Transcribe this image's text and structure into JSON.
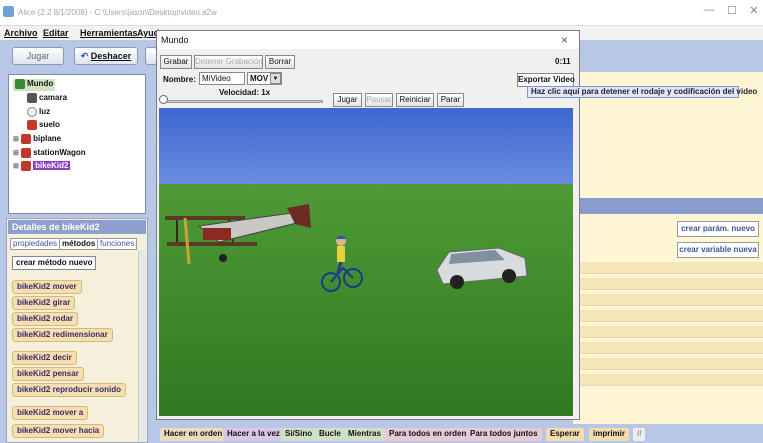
{
  "window": {
    "title": "Alice (2.2 8/1/2008) - C:\\Users\\jason\\Desktop\\video.a2w"
  },
  "menu": {
    "items": [
      "Archivo",
      "Editar",
      "Herramientas",
      "Ayuda"
    ]
  },
  "toolbar": {
    "play": "Jugar",
    "undo": "Deshacer"
  },
  "tree": {
    "root": "Mundo",
    "items": [
      "camara",
      "luz",
      "suelo",
      "biplane",
      "stationWagon",
      "bikeKid2"
    ]
  },
  "details": {
    "title": "Detalles de  bikeKid2",
    "tabs": [
      "propiedades",
      "métodos",
      "funciones"
    ],
    "new_method": "crear método nuevo",
    "methods": [
      "bikeKid2  mover",
      "bikeKid2  girar",
      "bikeKid2  rodar",
      "bikeKid2  redimensionar",
      "bikeKid2  decir",
      "bikeKid2  pensar",
      "bikeKid2  reproducir sonido",
      "bikeKid2  mover a",
      "bikeKid2  mover  hacia"
    ]
  },
  "editor": {
    "new_param": "crear parám. nuevo",
    "new_var": "crear variable nueva"
  },
  "bottom": {
    "items": [
      "Hacer en orden",
      "Hacer a la vez",
      "Si/Sino",
      "Bucle",
      "Mientras",
      "Para todos en orden",
      "Para todos juntos",
      "Esperar",
      "imprimir",
      "//"
    ]
  },
  "dialog": {
    "title": "Mundo",
    "close": "×",
    "record": "Grabar",
    "stop_record": "Detener Grabación",
    "clear": "Borrar",
    "time": "0:11",
    "name_label": "Nombre:",
    "name_value": "MiVideo",
    "format": "MOV",
    "export": "Exportar Video",
    "speed_label": "Velocidad: 1x",
    "speed": 0.0,
    "play": "Jugar",
    "pause": "Pausar",
    "restart": "Reiniciar",
    "stop": "Parar",
    "tooltip": "Haz clic aquí para detener el rodaje y codificación del video"
  },
  "colors": {
    "sky": "#3f6bd4",
    "grass": "#3d8a2a",
    "accent": "#b9c7e6"
  }
}
